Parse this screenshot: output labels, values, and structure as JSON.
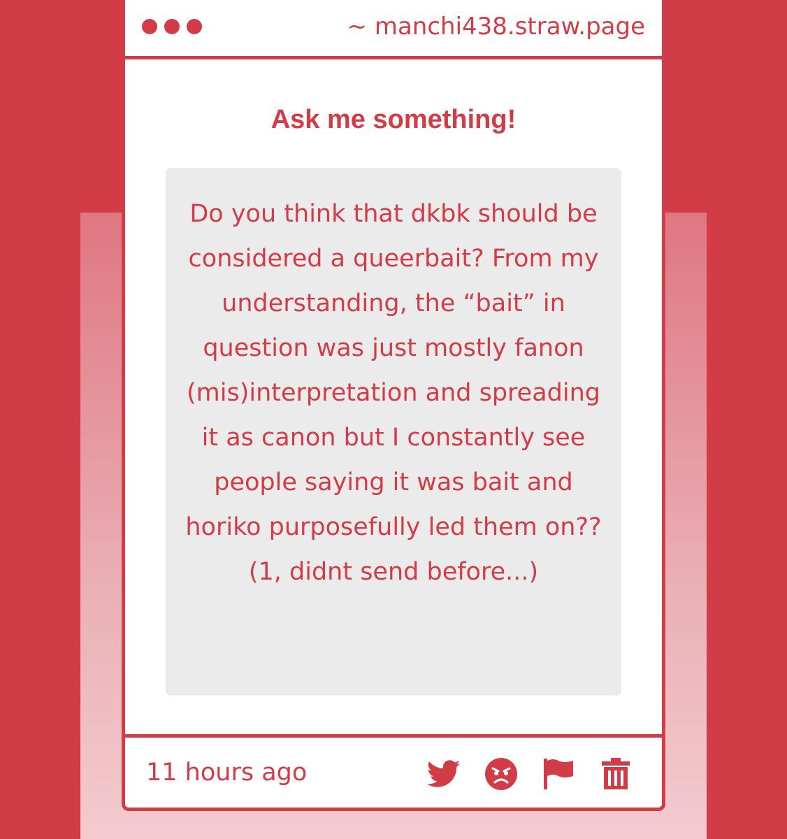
{
  "header": {
    "url": "~ manchi438.straw.page"
  },
  "main": {
    "title": "Ask me something!",
    "question": "Do you think that dkbk should be considered a queerbait? From my understanding, the “bait” in question was just mostly fanon (mis)interpretation and spreading it as canon but I constantly see people saying it was bait and horiko purposefully led them on?? (1, didnt send before...)"
  },
  "footer": {
    "time": "11 hours ago",
    "actions": [
      {
        "icon": "twitter-icon"
      },
      {
        "icon": "angry-face-icon"
      },
      {
        "icon": "flag-icon"
      },
      {
        "icon": "trash-icon"
      }
    ]
  },
  "colors": {
    "accent": "#d23c47",
    "box": "#ecebeb",
    "card": "#ffffff"
  }
}
